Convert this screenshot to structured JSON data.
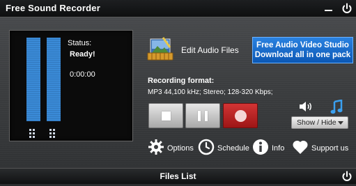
{
  "titlebar": {
    "title": "Free Sound Recorder"
  },
  "status": {
    "label": "Status:",
    "value": "Ready!",
    "time": "0:00:00"
  },
  "meters": {
    "left_level": 1.0,
    "right_level": 1.0
  },
  "edit_audio": {
    "label": "Edit Audio Files"
  },
  "promo": {
    "line1": "Free Audio Video Studio",
    "line2": "Download all in one pack"
  },
  "recording": {
    "format_label": "Recording format:",
    "format_value": "MP3 44,100 kHz; Stereo;  128-320 Kbps;"
  },
  "controls": {
    "show_hide_label": "Show / Hide"
  },
  "toolbar": {
    "options": "Options",
    "schedule": "Schedule",
    "info": "Info",
    "support": "Support us"
  },
  "files": {
    "title": "Files List"
  },
  "colors": {
    "accent_blue": "#3a8ad6",
    "record_red": "#c32222",
    "promo_blue": "#1c6fd0"
  }
}
